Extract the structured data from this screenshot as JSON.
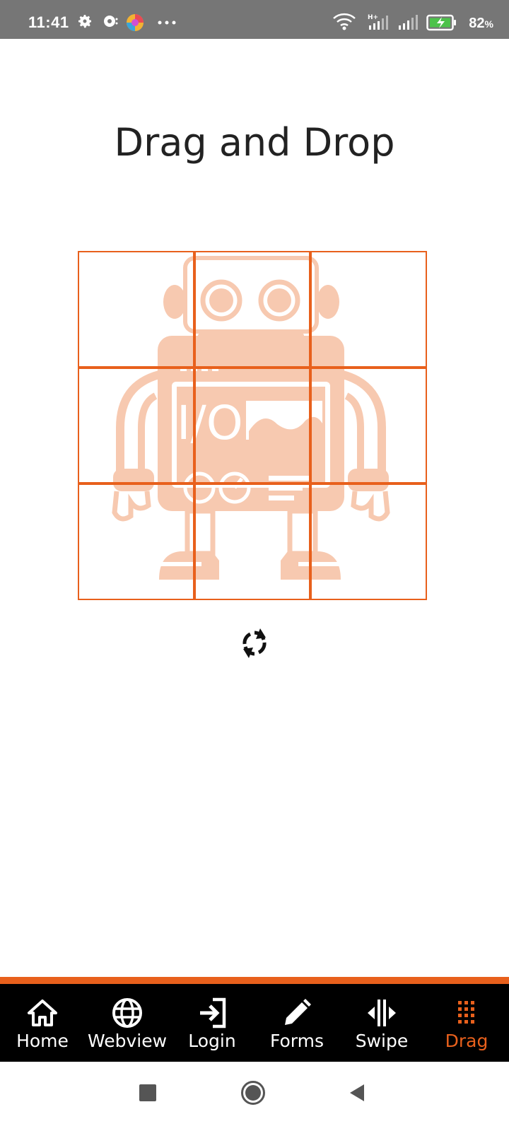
{
  "status_bar": {
    "time": "11:41",
    "battery_percent": "82",
    "battery_percent_unit": "%",
    "icons": [
      "gear-icon",
      "sync-icon",
      "browser-icon",
      "more-icon",
      "wifi-icon",
      "signal-h-plus-icon",
      "signal-icon",
      "battery-charging-icon"
    ]
  },
  "page": {
    "title": "Drag and Drop"
  },
  "puzzle": {
    "rows": 3,
    "cols": 3,
    "border_color": "#e8601c",
    "image_color": "#f7c9b0",
    "image_label": "I/O"
  },
  "tabs": [
    {
      "label": "Home",
      "icon": "home-icon",
      "active": false
    },
    {
      "label": "Webview",
      "icon": "globe-icon",
      "active": false
    },
    {
      "label": "Login",
      "icon": "login-icon",
      "active": false
    },
    {
      "label": "Forms",
      "icon": "pencil-icon",
      "active": false
    },
    {
      "label": "Swipe",
      "icon": "swipe-icon",
      "active": false
    },
    {
      "label": "Drag",
      "icon": "drag-grid-icon",
      "active": true
    }
  ],
  "colors": {
    "accent": "#e8601c",
    "tab_bar_bg": "#000000",
    "status_bar_bg": "#767676"
  }
}
